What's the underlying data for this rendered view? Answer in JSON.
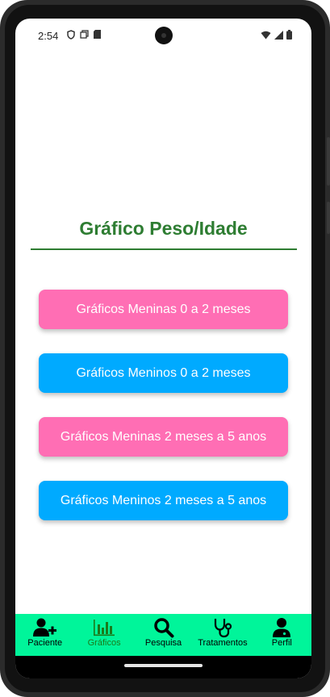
{
  "status": {
    "time": "2:54"
  },
  "page": {
    "title": "Gráfico Peso/Idade"
  },
  "buttons": [
    {
      "label": "Gráficos Meninas 0 a 2 meses",
      "color": "#ff6eb4"
    },
    {
      "label": "Gráficos Meninos 0 a 2 meses",
      "color": "#00aaff"
    },
    {
      "label": "Gráficos Meninas 2 meses a 5 anos",
      "color": "#ff6eb4"
    },
    {
      "label": "Gráficos Meninos 2 meses a 5 anos",
      "color": "#00aaff"
    }
  ],
  "nav": [
    {
      "label": "Paciente",
      "icon": "add-user-icon"
    },
    {
      "label": "Gráficos",
      "icon": "bar-chart-icon",
      "active": true
    },
    {
      "label": "Pesquisa",
      "icon": "search-icon"
    },
    {
      "label": "Tratamentos",
      "icon": "stethoscope-icon"
    },
    {
      "label": "Perfil",
      "icon": "doctor-icon"
    }
  ],
  "colors": {
    "accent_green": "#2e7d32",
    "nav_background": "#00f59a",
    "active_nav": "#1b7a1b"
  }
}
